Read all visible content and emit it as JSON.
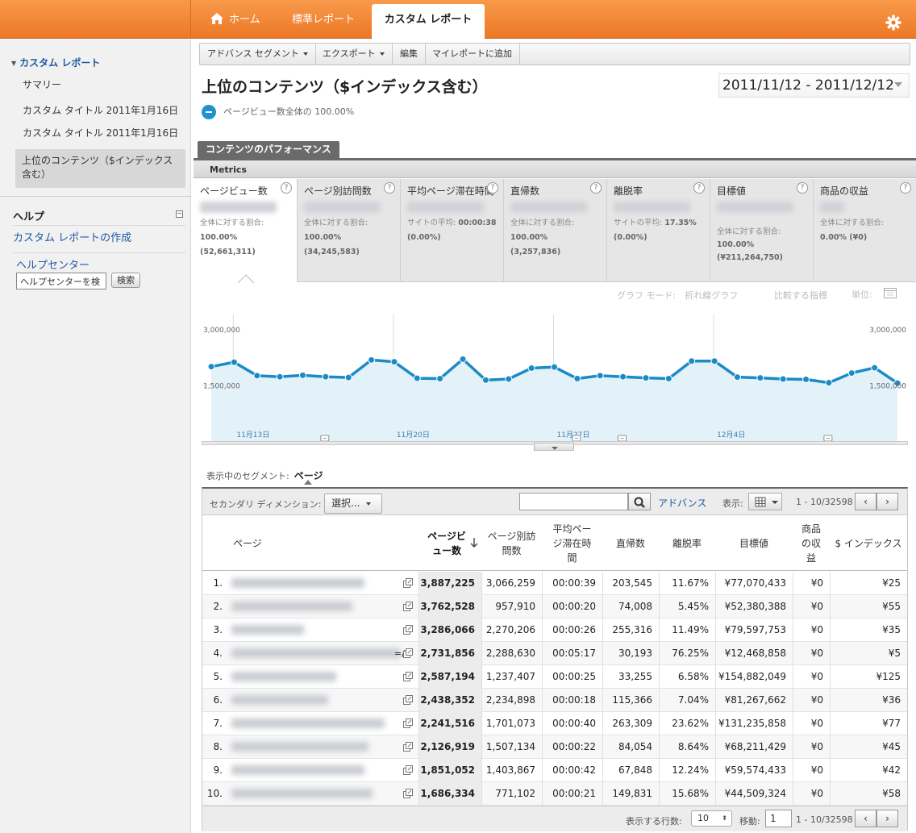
{
  "topnav": {
    "tabs": [
      {
        "label": "ホーム",
        "icon": "home-icon"
      },
      {
        "label": "標準レポート"
      },
      {
        "label": "カスタム レポート",
        "active": true
      }
    ],
    "settings_icon": "gear-icon"
  },
  "sidebar": {
    "section_title": "カスタム レポート",
    "items": [
      {
        "label": "サマリー"
      },
      {
        "label": "カスタム タイトル 2011年1月16日"
      },
      {
        "label": "カスタム タイトル 2011年1月16日"
      },
      {
        "label": "上位のコンテンツ（$インデックス含む）",
        "selected": true
      }
    ],
    "help": {
      "title": "ヘルプ",
      "link_create": "カスタム レポートの作成",
      "help_center": "ヘルプセンター",
      "search_value": "ヘルプセンターを検",
      "search_button": "検索"
    }
  },
  "toolbar": {
    "advanced_segment": "アドバンス セグメント",
    "export": "エクスポート",
    "edit": "編集",
    "add_to_dashboard": "マイレポートに追加"
  },
  "report": {
    "title": "上位のコンテンツ（$インデックス含む）",
    "date_range": "2011/11/12 - 2011/12/12",
    "segment_summary": "ページビュー数全体の 100.00%",
    "performance_tab": "コンテンツのパフォーマンス",
    "metrics_label": "Metrics"
  },
  "scorecards": [
    {
      "label": "ページビュー数",
      "sub_label": "全体に対する割合:",
      "sub_value": "100.00% (52,661,311)",
      "active": true
    },
    {
      "label": "ページ別訪問数",
      "sub_label": "全体に対する割合:",
      "sub_value": "100.00% (34,245,583)"
    },
    {
      "label": "平均ページ滞在時間",
      "sub_label": "サイトの平均:",
      "sub_bold": "00:00:38",
      "sub_value": "(0.00%)"
    },
    {
      "label": "直帰数",
      "sub_label": "全体に対する割合:",
      "sub_value": "100.00% (3,257,836)"
    },
    {
      "label": "離脱率",
      "sub_label": "サイトの平均:",
      "sub_bold": "17.35%",
      "sub_value": "(0.00%)"
    },
    {
      "label": "目標値",
      "sub_label": "全体に対する割合:",
      "sub_value": "100.00%",
      "sub_value2": "(¥211,264,750)"
    },
    {
      "label": "商品の収益",
      "sub_label": "全体に対する割合:",
      "sub_value": "0.00% (¥0)"
    }
  ],
  "chart_controls": {
    "graph_mode": "グラフ モード:　折れ線グラフ",
    "compare": "比較する指標",
    "unit": "単位:"
  },
  "chart_data": {
    "type": "line",
    "series": [
      {
        "values": [
          1990000,
          2110000,
          1750000,
          1720000,
          1760000,
          1720000,
          1700000,
          2170000,
          2120000,
          1680000,
          1670000,
          2190000,
          1630000,
          1660000,
          1950000,
          1980000,
          1670000,
          1750000,
          1720000,
          1690000,
          1670000,
          2140000,
          2140000,
          1710000,
          1690000,
          1660000,
          1650000,
          1560000,
          1820000,
          1960000,
          1550000
        ]
      }
    ],
    "y_ticks": [
      "3,000,000",
      "1,500,000"
    ],
    "ylim": [
      0,
      3600000
    ],
    "x_labels": [
      "11月13日",
      "11月20日",
      "11月27日",
      "12月4日"
    ],
    "annotation_markers": [
      5,
      16,
      18,
      27
    ]
  },
  "segment": {
    "label": "表示中のセグメント:",
    "value": "ページ"
  },
  "table": {
    "secondary_dim_label": "セカンダリ ディメンション:",
    "secondary_dim_value": "選択...",
    "advanced_link": "アドバンス",
    "show_label": "表示:",
    "range": "1 - 10/32598",
    "headers": {
      "page": "ページ",
      "pageviews": "ページビュー数",
      "unique": "ページ別訪問数",
      "avg_time": "平均ページ滞在時間",
      "bounces": "直帰数",
      "exit_rate": "離脱率",
      "goal_value": "目標値",
      "revenue": "商品の収益",
      "dollar_index": "$ インデックス"
    },
    "rows": [
      {
        "idx": "1.",
        "pageviews": "3,887,225",
        "unique": "3,066,259",
        "avg_time": "00:00:39",
        "bounces": "203,545",
        "exit_rate": "11.67%",
        "goal": "¥77,070,433",
        "revenue": "¥0",
        "index": "¥25"
      },
      {
        "idx": "2.",
        "pageviews": "3,762,528",
        "unique": "957,910",
        "avg_time": "00:00:20",
        "bounces": "74,008",
        "exit_rate": "5.45%",
        "goal": "¥52,380,388",
        "revenue": "¥0",
        "index": "¥55"
      },
      {
        "idx": "3.",
        "pageviews": "3,286,066",
        "unique": "2,270,206",
        "avg_time": "00:00:26",
        "bounces": "255,316",
        "exit_rate": "11.49%",
        "goal": "¥79,597,753",
        "revenue": "¥0",
        "index": "¥35"
      },
      {
        "idx": "4.",
        "pageviews": "2,731,856",
        "unique": "2,288,630",
        "avg_time": "00:05:17",
        "bounces": "30,193",
        "exit_rate": "76.25%",
        "goal": "¥12,468,858",
        "revenue": "¥0",
        "index": "¥5",
        "suffix": "=/"
      },
      {
        "idx": "5.",
        "pageviews": "2,587,194",
        "unique": "1,237,407",
        "avg_time": "00:00:25",
        "bounces": "33,255",
        "exit_rate": "6.58%",
        "goal": "¥154,882,049",
        "revenue": "¥0",
        "index": "¥125"
      },
      {
        "idx": "6.",
        "pageviews": "2,438,352",
        "unique": "2,234,898",
        "avg_time": "00:00:18",
        "bounces": "115,366",
        "exit_rate": "7.04%",
        "goal": "¥81,267,662",
        "revenue": "¥0",
        "index": "¥36"
      },
      {
        "idx": "7.",
        "pageviews": "2,241,516",
        "unique": "1,701,073",
        "avg_time": "00:00:40",
        "bounces": "263,309",
        "exit_rate": "23.62%",
        "goal": "¥131,235,858",
        "revenue": "¥0",
        "index": "¥77"
      },
      {
        "idx": "8.",
        "pageviews": "2,126,919",
        "unique": "1,507,134",
        "avg_time": "00:00:22",
        "bounces": "84,054",
        "exit_rate": "8.64%",
        "goal": "¥68,211,429",
        "revenue": "¥0",
        "index": "¥45"
      },
      {
        "idx": "9.",
        "pageviews": "1,851,052",
        "unique": "1,403,867",
        "avg_time": "00:00:42",
        "bounces": "67,848",
        "exit_rate": "12.24%",
        "goal": "¥59,574,433",
        "revenue": "¥0",
        "index": "¥42"
      },
      {
        "idx": "10.",
        "pageviews": "1,686,334",
        "unique": "771,102",
        "avg_time": "00:00:21",
        "bounces": "149,831",
        "exit_rate": "15.68%",
        "goal": "¥44,509,324",
        "revenue": "¥0",
        "index": "¥58"
      }
    ],
    "footer": {
      "rows_label": "表示する行数:",
      "rows_value": "10",
      "goto_label": "移動:",
      "goto_value": "1",
      "range": "1 - 10/32598"
    }
  },
  "colors": {
    "nav_orange": "#ec7826",
    "link_blue": "#1b5aa0",
    "chart_line": "#1b8bc6",
    "chart_fill": "#e3f1f9"
  }
}
